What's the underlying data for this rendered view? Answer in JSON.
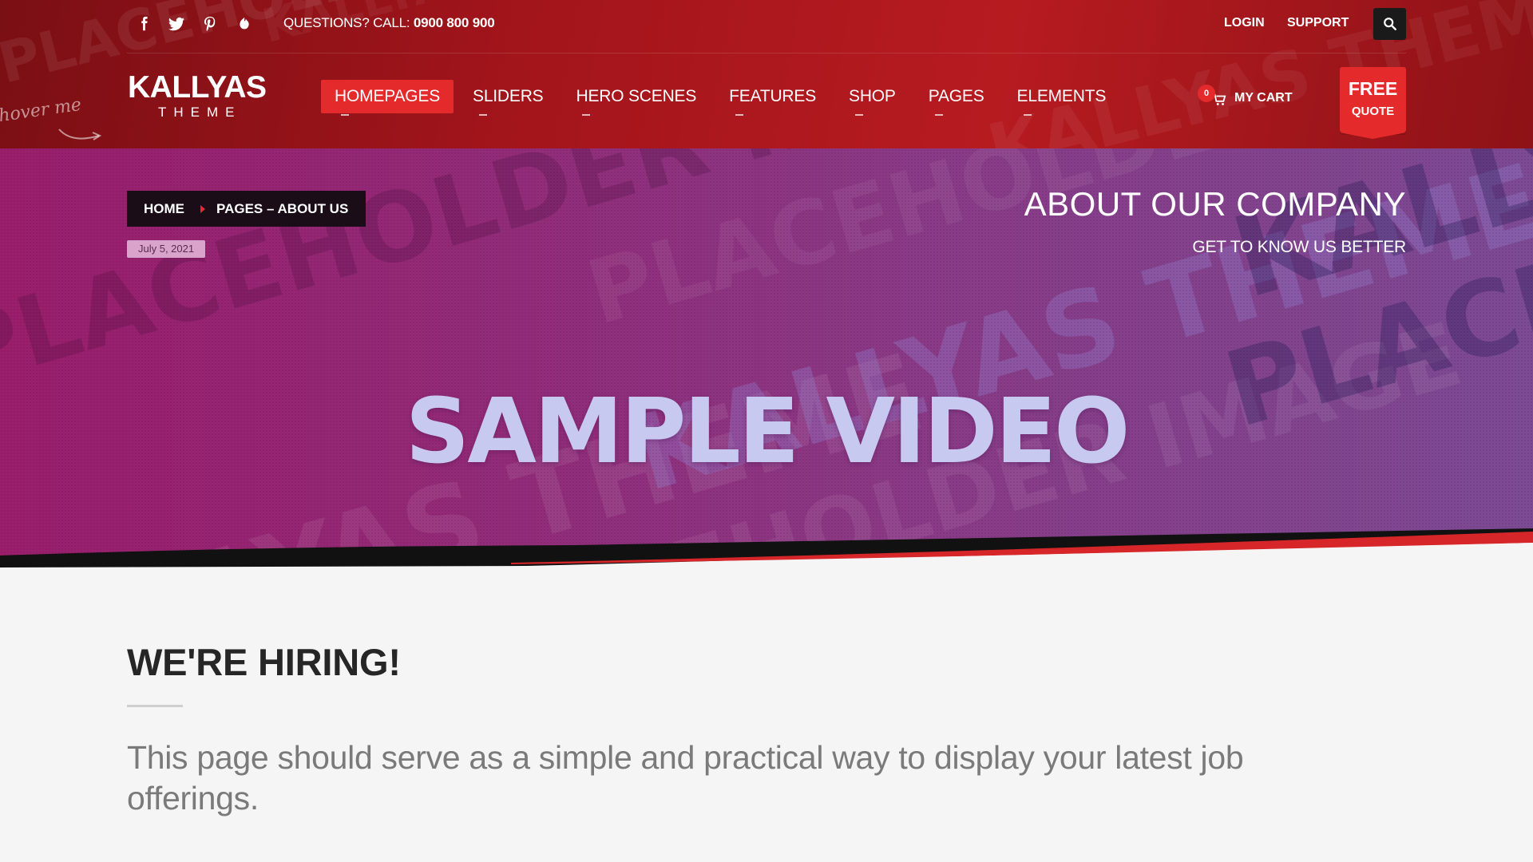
{
  "header": {
    "social": [
      {
        "icon": "facebook-icon"
      },
      {
        "icon": "twitter-icon"
      },
      {
        "icon": "pinterest-icon"
      },
      {
        "icon": "leaf-icon"
      }
    ],
    "contact_prefix": "QUESTIONS? CALL: ",
    "contact_phone": "0900 800 900",
    "login_label": "LOGIN",
    "support_label": "SUPPORT",
    "search_icon": "search-icon",
    "logo_brand": "KALLYAS",
    "logo_sub": "THEME",
    "hover_hint": "hover me",
    "nav": [
      "HOMEPAGES",
      "SLIDERS",
      "HERO SCENES",
      "FEATURES",
      "SHOP",
      "PAGES",
      "ELEMENTS"
    ],
    "nav_active": "HOMEPAGES",
    "cart_count": "0",
    "cart_label": "MY CART",
    "quote_line1": "FREE",
    "quote_line2": "QUOTE",
    "colors": {
      "header_red": "#b61b20",
      "accent": "#e52a2c",
      "dark": "#1b0d18"
    }
  },
  "hero": {
    "breadcrumb_home": "HOME",
    "breadcrumb_current": "PAGES – ABOUT US",
    "date": "July 5, 2021",
    "title": "ABOUT OUR COMPANY",
    "subtitle": "GET TO KNOW US BETTER",
    "video_text": "SAMPLE VIDEO",
    "watermarks": [
      "KALLYAS THEME",
      "PLACEHOLDER IMAGE"
    ],
    "colors": {
      "hero_left": "#9a1e6c",
      "hero_right": "#7d4a94",
      "video_text": "#c8c9f0"
    }
  },
  "content": {
    "title": "WE'RE HIRING!",
    "text": "This page should serve as a simple and practical way to display your latest job offerings."
  }
}
